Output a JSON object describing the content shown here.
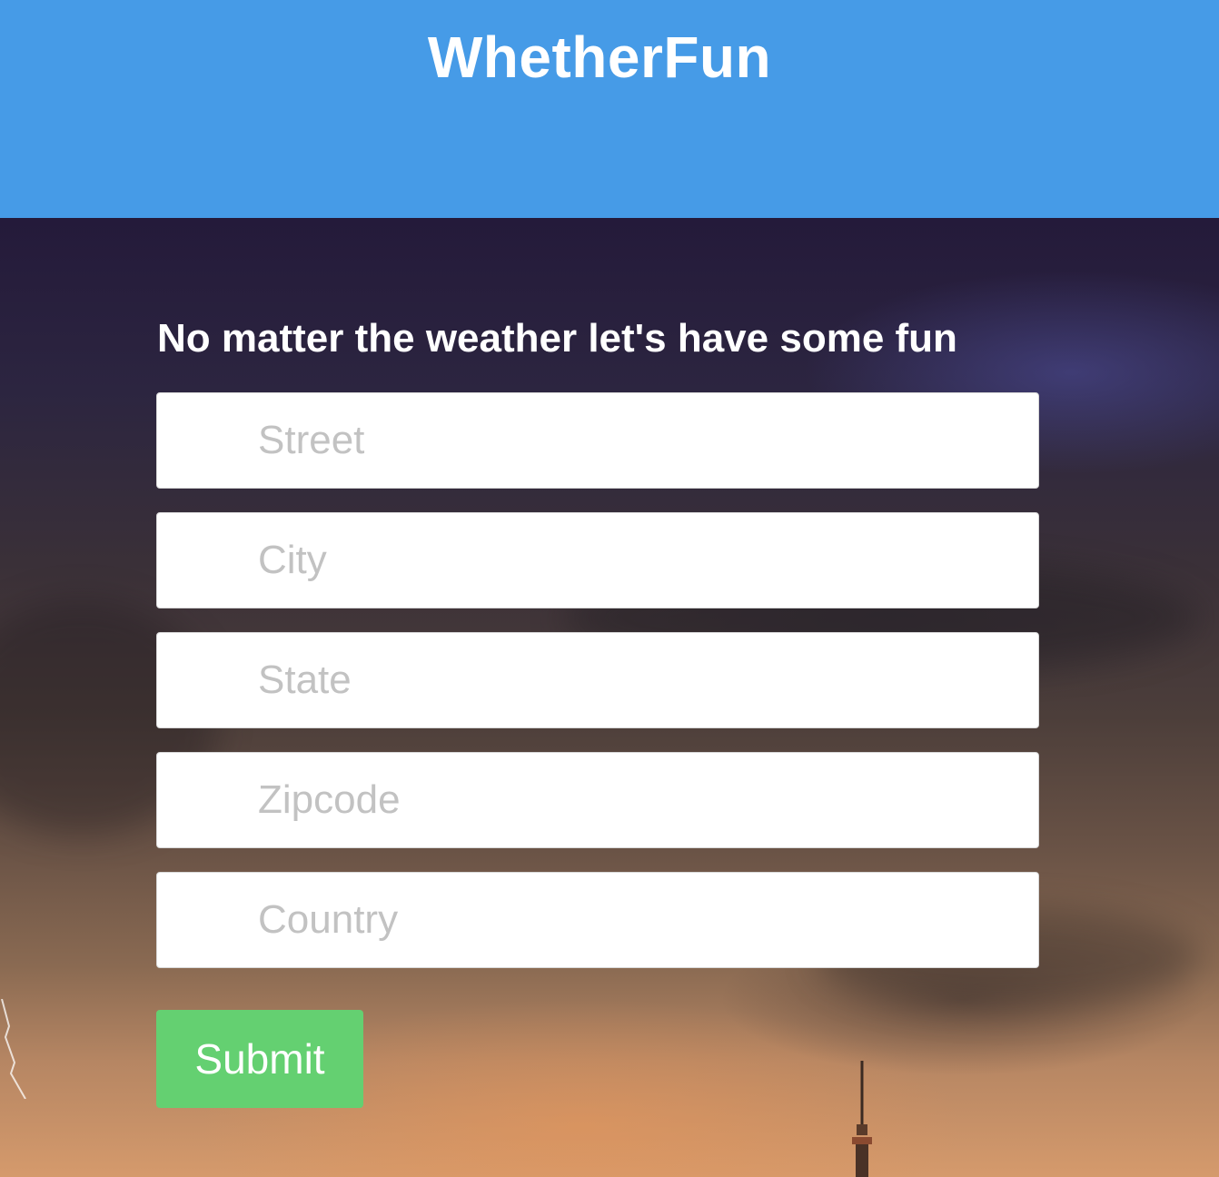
{
  "header": {
    "title": "WhetherFun",
    "background_color": "#469be7"
  },
  "main": {
    "tagline": "No matter the weather let's have some fun",
    "fields": [
      {
        "name": "street",
        "placeholder": "Street",
        "value": ""
      },
      {
        "name": "city",
        "placeholder": "City",
        "value": ""
      },
      {
        "name": "state",
        "placeholder": "State",
        "value": ""
      },
      {
        "name": "zipcode",
        "placeholder": "Zipcode",
        "value": ""
      },
      {
        "name": "country",
        "placeholder": "Country",
        "value": ""
      }
    ],
    "submit_label": "Submit",
    "submit_color": "#64d071"
  }
}
